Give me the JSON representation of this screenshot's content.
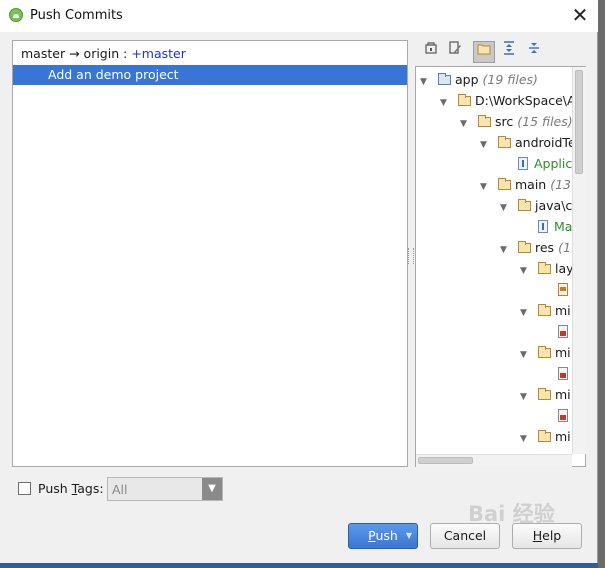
{
  "window": {
    "title": "Push Commits",
    "close_glyph": "✕"
  },
  "commits": {
    "branch_source": "master",
    "branch_arrow": "→",
    "branch_target": "origin :",
    "branch_new": "+master",
    "items": [
      {
        "label": "Add an demo project",
        "selected": true
      }
    ]
  },
  "toolbar": {
    "icons": [
      "mark-icon",
      "edit-source-icon",
      "group-by-directory-icon",
      "expand-all-icon",
      "collapse-all-icon"
    ],
    "active_icon": "group-by-directory-icon"
  },
  "tree": {
    "nodes": [
      {
        "label": "app",
        "count": "(19 files)",
        "kind": "module"
      },
      {
        "label": "D:\\WorkSpace\\A",
        "count": "",
        "kind": "folder"
      },
      {
        "label": "src",
        "count": "(15 files)",
        "kind": "folder"
      },
      {
        "label": "androidTe",
        "count": "",
        "kind": "folder"
      },
      {
        "label": "Applic",
        "count": "",
        "kind": "file-java",
        "color": "#2e8b2e"
      },
      {
        "label": "main",
        "count": "(13",
        "kind": "folder"
      },
      {
        "label": "java\\c",
        "count": "",
        "kind": "folder"
      },
      {
        "label": "Ma",
        "count": "",
        "kind": "file-java",
        "color": "#2e8b2e"
      },
      {
        "label": "res",
        "count": "(1",
        "kind": "folder"
      },
      {
        "label": "lay",
        "count": "",
        "kind": "folder"
      },
      {
        "label": "",
        "count": "",
        "kind": "file-xml"
      },
      {
        "label": "mi",
        "count": "",
        "kind": "folder"
      },
      {
        "label": "",
        "count": "",
        "kind": "file-img"
      },
      {
        "label": "mi",
        "count": "",
        "kind": "folder"
      },
      {
        "label": "",
        "count": "",
        "kind": "file-img"
      },
      {
        "label": "mi",
        "count": "",
        "kind": "folder"
      },
      {
        "label": "",
        "count": "",
        "kind": "file-img"
      },
      {
        "label": "mi",
        "count": "",
        "kind": "folder"
      }
    ]
  },
  "push_tags": {
    "checked": false,
    "label_before": "Push ",
    "label_mnemonic": "T",
    "label_after": "ags:",
    "select_value": "All"
  },
  "buttons": {
    "push_mnemonic": "P",
    "push_rest": "ush",
    "cancel": "Cancel",
    "help_mnemonic": "H",
    "help_rest": "elp"
  },
  "watermark": "Bai 经验"
}
